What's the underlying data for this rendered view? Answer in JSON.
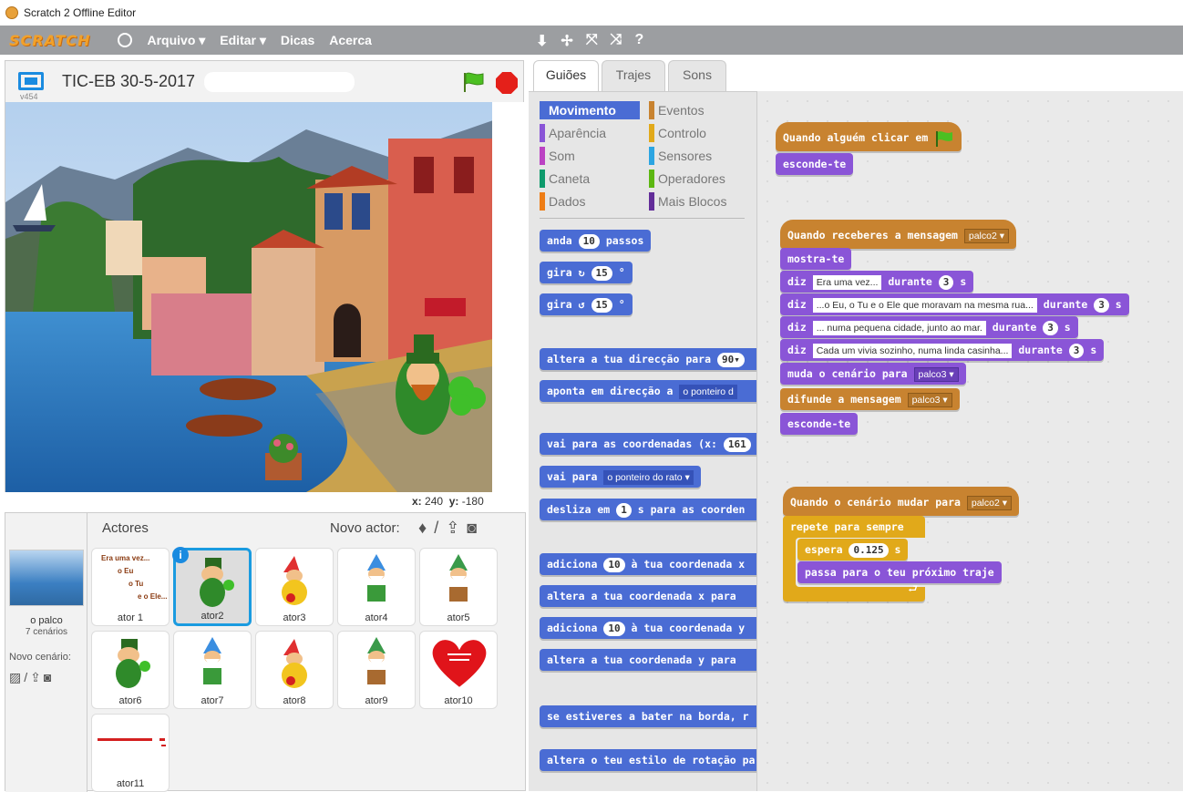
{
  "window": {
    "title": "Scratch 2 Offline Editor"
  },
  "menubar": {
    "logo": "SCRATCH",
    "items": [
      "Arquivo ▾",
      "Editar ▾",
      "Dicas",
      "Acerca"
    ],
    "tools": [
      "⬇",
      "✢",
      "⤧",
      "⤨",
      "?"
    ]
  },
  "stage": {
    "version": "v454",
    "project_title": "TIC-EB 30-5-2017",
    "coords": {
      "x_label": "x:",
      "x_value": "240",
      "y_label": "y:",
      "y_value": "-180"
    }
  },
  "sprites_pane": {
    "header": "Actores",
    "new_sprite_label": "Novo actor:",
    "stage_label": "o palco",
    "stage_backdrops": "7 cenários",
    "new_backdrop_label": "Novo cenário:",
    "sprites": [
      {
        "name": "ator 1"
      },
      {
        "name": "ator2",
        "selected": true
      },
      {
        "name": "ator3"
      },
      {
        "name": "ator4"
      },
      {
        "name": "ator5"
      },
      {
        "name": "ator6"
      },
      {
        "name": "ator7"
      },
      {
        "name": "ator8"
      },
      {
        "name": "ator9"
      },
      {
        "name": "ator10"
      },
      {
        "name": "ator11"
      }
    ],
    "ator1_lines": [
      "Era uma vez...",
      "o Eu",
      "o Tu",
      "e o Ele..."
    ]
  },
  "tabs": [
    "Guiões",
    "Trajes",
    "Sons"
  ],
  "categories": [
    {
      "name": "Movimento",
      "color": "#4a6cd4"
    },
    {
      "name": "Eventos",
      "color": "#c88330"
    },
    {
      "name": "Aparência",
      "color": "#8a55d7"
    },
    {
      "name": "Controlo",
      "color": "#e1a91a"
    },
    {
      "name": "Som",
      "color": "#bb42c3"
    },
    {
      "name": "Sensores",
      "color": "#2ca5e2"
    },
    {
      "name": "Caneta",
      "color": "#0e9a6c"
    },
    {
      "name": "Operadores",
      "color": "#5cb712"
    },
    {
      "name": "Dados",
      "color": "#ee7d16"
    },
    {
      "name": "Mais Blocos",
      "color": "#632d99"
    }
  ],
  "palette": {
    "b1": {
      "a": "anda",
      "v": "10",
      "b": "passos"
    },
    "b2": {
      "a": "gira",
      "arrow": "↻",
      "v": "15",
      "b": "°"
    },
    "b3": {
      "a": "gira",
      "arrow": "↺",
      "v": "15",
      "b": "°"
    },
    "b4": {
      "a": "altera a tua direcção para",
      "v": "90▾"
    },
    "b5": {
      "a": "aponta em direcção a",
      "v": "o ponteiro d"
    },
    "b6": {
      "a": "vai para as coordenadas (x:",
      "v": "161"
    },
    "b7": {
      "a": "vai para",
      "v": "o ponteiro do rato ▾"
    },
    "b8": {
      "a": "desliza em",
      "v": "1",
      "b": "s para as coorden"
    },
    "b9": {
      "a": "adiciona",
      "v": "10",
      "b": "à tua coordenada x"
    },
    "b10": {
      "a": "altera a tua coordenada x para"
    },
    "b11": {
      "a": "adiciona",
      "v": "10",
      "b": "à tua coordenada y"
    },
    "b12": {
      "a": "altera a tua coordenada y para"
    },
    "b13": {
      "a": "se estiveres a bater na borda, r"
    },
    "b14": {
      "a": "altera o teu estilo de rotação pa"
    }
  },
  "scripts": {
    "s1": {
      "hat": "Quando alguém clicar em",
      "b1": "esconde-te"
    },
    "s2": {
      "hat": "Quando receberes a mensagem",
      "hat_msg": "palco2 ▾",
      "show": "mostra-te",
      "say": "diz",
      "during": "durante",
      "secs": "3",
      "s": "s",
      "t1": "Era uma vez...",
      "t2": "...o Eu, o Tu e o Ele que moravam na mesma rua...",
      "t3": "... numa pequena cidade, junto ao mar.",
      "t4": "Cada um vivia sozinho, numa linda casinha...",
      "backdrop": "muda o cenário para",
      "backdrop_val": "palco3 ▾",
      "broadcast": "difunde a mensagem",
      "broadcast_val": "palco3 ▾",
      "hide": "esconde-te"
    },
    "s3": {
      "hat": "Quando o cenário mudar para",
      "hat_val": "palco2 ▾",
      "forever": "repete para sempre",
      "wait": "espera",
      "wait_val": "0.125",
      "wait_s": "s",
      "next": "passa para o teu próximo traje"
    }
  }
}
